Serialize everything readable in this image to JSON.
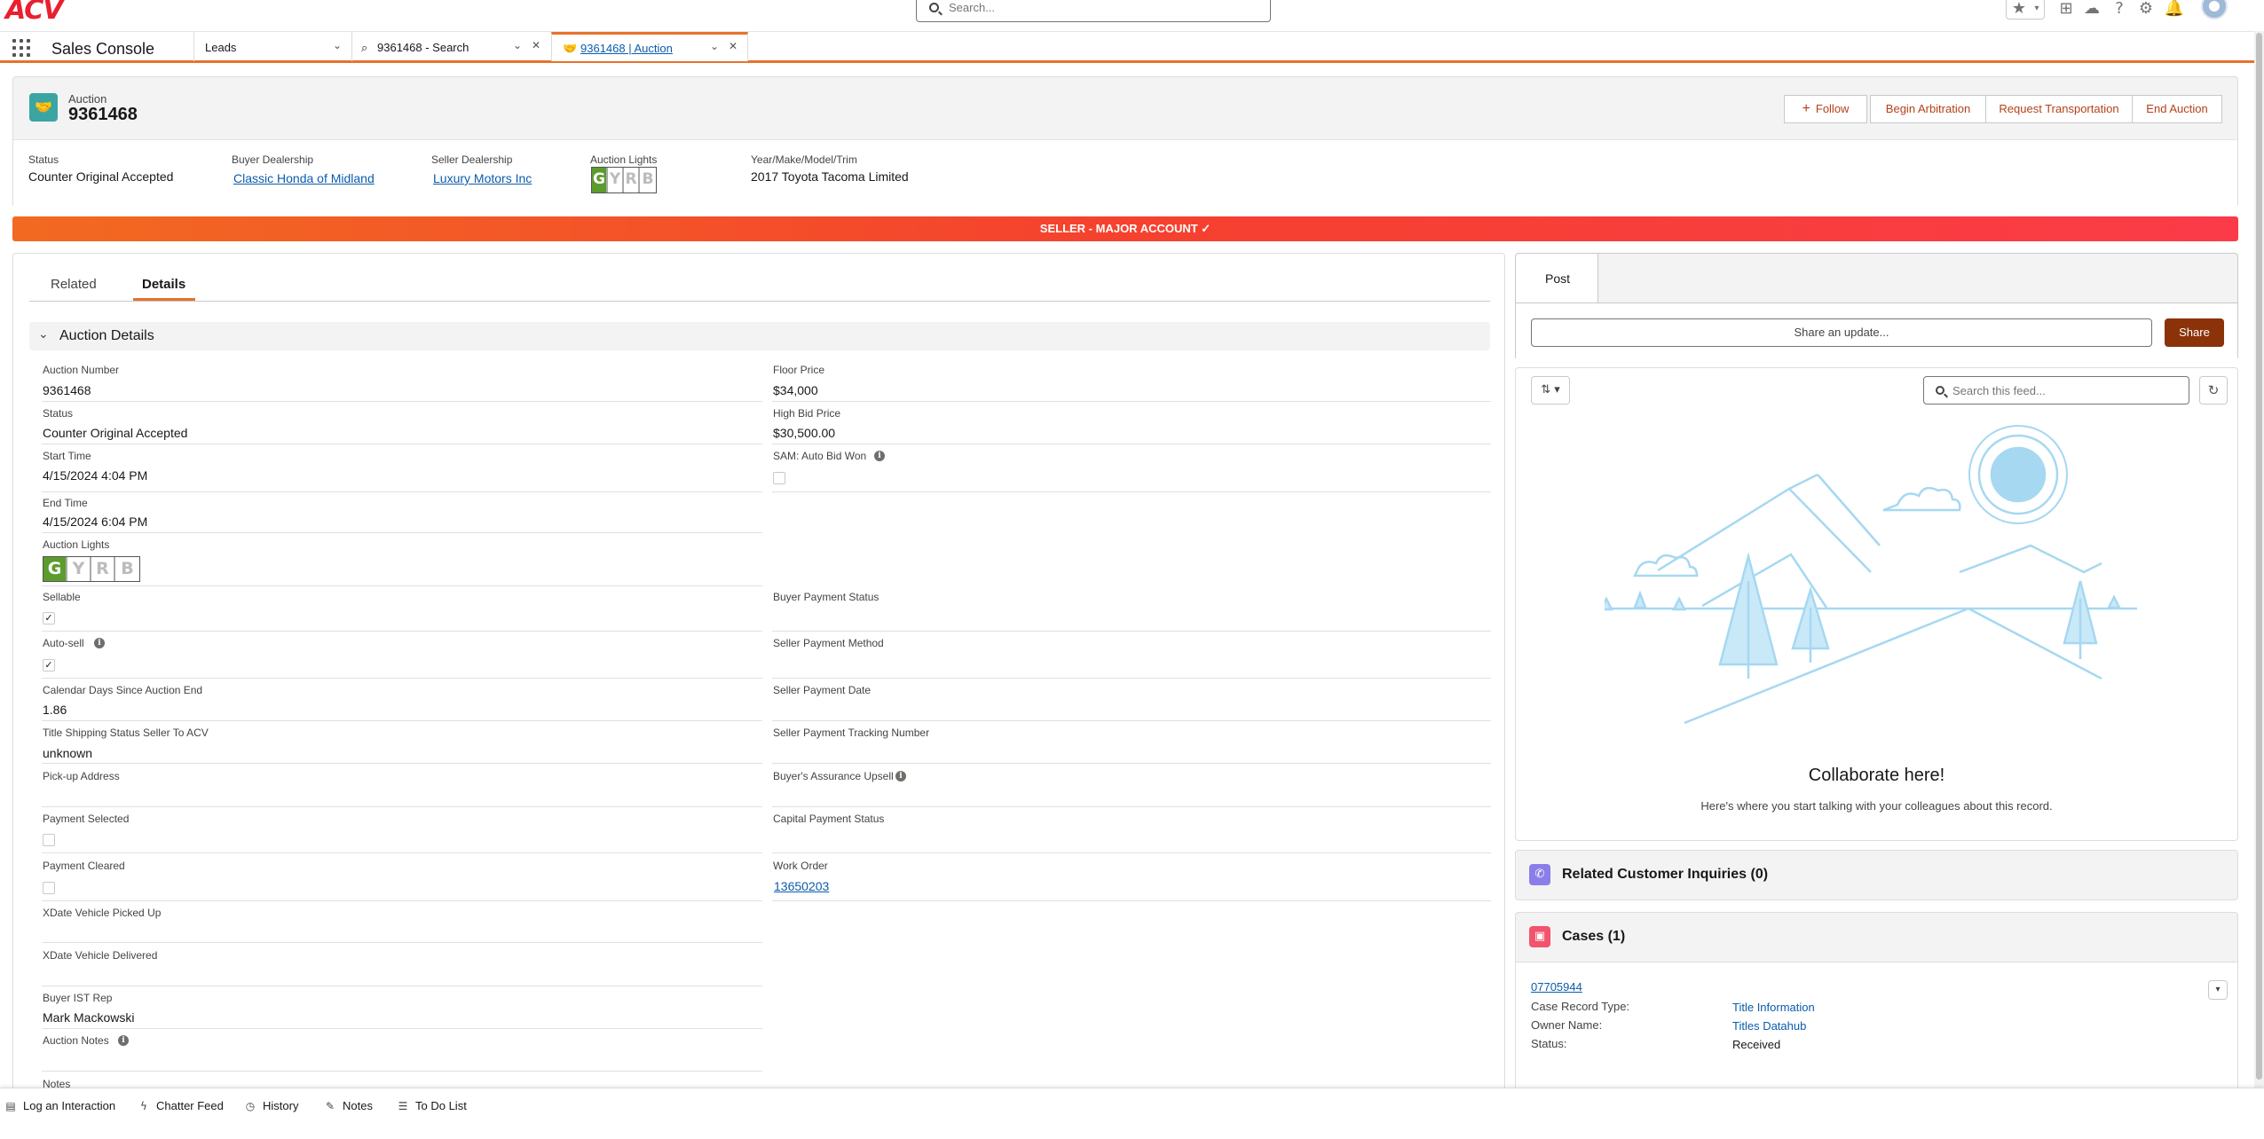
{
  "logo": {
    "text": "ACV"
  },
  "global_search": {
    "placeholder": "Search..."
  },
  "header_icons": [
    "star-icon",
    "add-icon",
    "cloud-icon",
    "help-icon",
    "gear-icon",
    "bell-icon"
  ],
  "console": {
    "app_name": "Sales Console",
    "tabs": [
      {
        "label": "Leads"
      },
      {
        "label": "9361468 - Search"
      },
      {
        "label": "9361468 | Auction"
      }
    ]
  },
  "record": {
    "type_label": "Auction",
    "title": "9361468",
    "buttons": {
      "follow": "Follow",
      "arbitration": "Begin Arbitration",
      "transport": "Request Transportation",
      "end": "End Auction"
    },
    "highlights": {
      "status_label": "Status",
      "status_value": "Counter Original Accepted",
      "buyer_label": "Buyer Dealership",
      "buyer_value": "Classic Honda of Midland",
      "seller_label": "Seller Dealership",
      "seller_value": "Luxury Motors Inc",
      "lights_label": "Auction Lights",
      "ymm_label": "Year/Make/Model/Trim",
      "ymm_value": "2017 Toyota Tacoma Limited"
    },
    "lights": [
      "G",
      "Y",
      "R",
      "B"
    ]
  },
  "banner": {
    "text": "SELLER - MAJOR ACCOUNT ✓"
  },
  "record_tabs": {
    "related": "Related",
    "details": "Details"
  },
  "section": {
    "title": "Auction Details"
  },
  "left_fields": {
    "auction_number": {
      "label": "Auction Number",
      "value": "9361468"
    },
    "status": {
      "label": "Status",
      "value": "Counter Original Accepted"
    },
    "start_time": {
      "label": "Start Time",
      "value": "4/15/2024 4:04 PM"
    },
    "end_time": {
      "label": "End Time",
      "value": "4/15/2024 6:04 PM"
    },
    "auction_lights": {
      "label": "Auction Lights"
    },
    "sellable": {
      "label": "Sellable",
      "checked": true
    },
    "auto_sell": {
      "label": "Auto-sell",
      "checked": true
    },
    "calendar_days": {
      "label": "Calendar Days Since Auction End",
      "value": "1.86"
    },
    "title_shipping": {
      "label": "Title Shipping Status Seller To ACV",
      "value": "unknown"
    },
    "pickup_address": {
      "label": "Pick-up Address",
      "value": ""
    },
    "payment_selected": {
      "label": "Payment Selected",
      "checked": false
    },
    "payment_cleared": {
      "label": "Payment Cleared",
      "checked": false
    },
    "xdate_picked": {
      "label": "XDate Vehicle Picked Up",
      "value": ""
    },
    "xdate_delivered": {
      "label": "XDate Vehicle Delivered",
      "value": ""
    },
    "buyer_ist": {
      "label": "Buyer IST Rep",
      "value": "Mark Mackowski"
    },
    "auction_notes": {
      "label": "Auction Notes",
      "value": ""
    },
    "notes": {
      "label": "Notes"
    }
  },
  "right_fields": {
    "floor_price": {
      "label": "Floor Price",
      "value": "$34,000"
    },
    "high_bid": {
      "label": "High Bid Price",
      "value": "$30,500.00"
    },
    "sam_auto": {
      "label": "SAM: Auto Bid Won",
      "checked": false
    },
    "buyer_payment_status": {
      "label": "Buyer Payment Status",
      "value": ""
    },
    "seller_payment_method": {
      "label": "Seller Payment Method",
      "value": ""
    },
    "seller_payment_date": {
      "label": "Seller Payment Date",
      "value": ""
    },
    "seller_tracking": {
      "label": "Seller Payment Tracking Number",
      "value": ""
    },
    "assurance_upsell": {
      "label": "Buyer's Assurance Upsell",
      "value": ""
    },
    "capital_payment": {
      "label": "Capital Payment Status",
      "value": ""
    },
    "work_order": {
      "label": "Work Order",
      "value": "13650203"
    }
  },
  "publisher": {
    "tab": "Post",
    "placeholder": "Share an update...",
    "share": "Share"
  },
  "feed": {
    "search_placeholder": "Search this feed...",
    "empty_title": "Collaborate here!",
    "empty_sub": "Here's where you start talking with your colleagues about this record."
  },
  "related_inquiries": {
    "title": "Related Customer Inquiries (0)"
  },
  "cases": {
    "title": "Cases (1)",
    "case_number": "07705944",
    "record_type_label": "Case Record Type:",
    "record_type_value": "Title Information",
    "owner_label": "Owner Name:",
    "owner_value": "Titles Datahub",
    "status_label": "Status:",
    "status_value": "Received"
  },
  "utility_bar": [
    "Log an Interaction",
    "Chatter Feed",
    "History",
    "Notes",
    "To Do List"
  ],
  "colors": {
    "brand_orange": "#e8722b",
    "link": "#0b5cab",
    "share_button": "#8b3209",
    "light_green": "#5c9c2e"
  }
}
